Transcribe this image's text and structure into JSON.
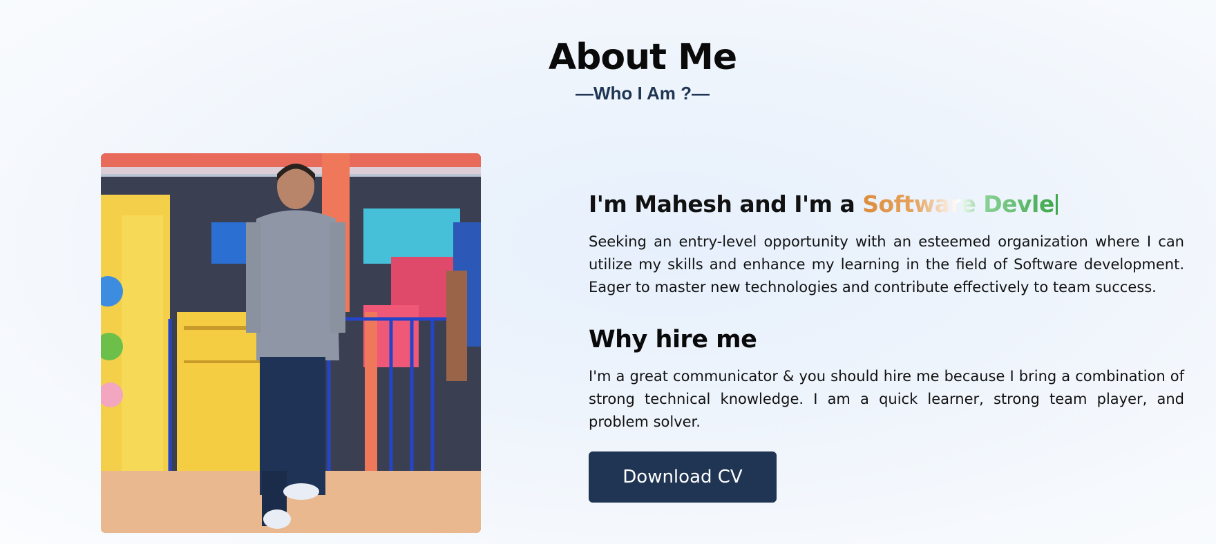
{
  "header": {
    "title": "About Me",
    "subtitle": "—Who I Am ?—"
  },
  "photo": {
    "icon": "profile-photo"
  },
  "intro": {
    "prefix": "I'm Mahesh and I'm a ",
    "role": "Software Devle"
  },
  "summary": "Seeking an entry-level opportunity with an esteemed organization where I can utilize my skills and enhance my learning in the field of Software development. Eager to master new technologies and contribute effectively to team success.",
  "why_hire": {
    "heading": "Why hire me",
    "text": "I'm a great communicator & you should hire me because I bring a combination of strong technical knowledge. I am a quick learner, strong team player, and problem solver."
  },
  "download_button": {
    "label": "Download CV"
  },
  "colors": {
    "accent": "#1f3553",
    "role_start": "#dc8c3c",
    "role_end": "#3ea84c"
  }
}
